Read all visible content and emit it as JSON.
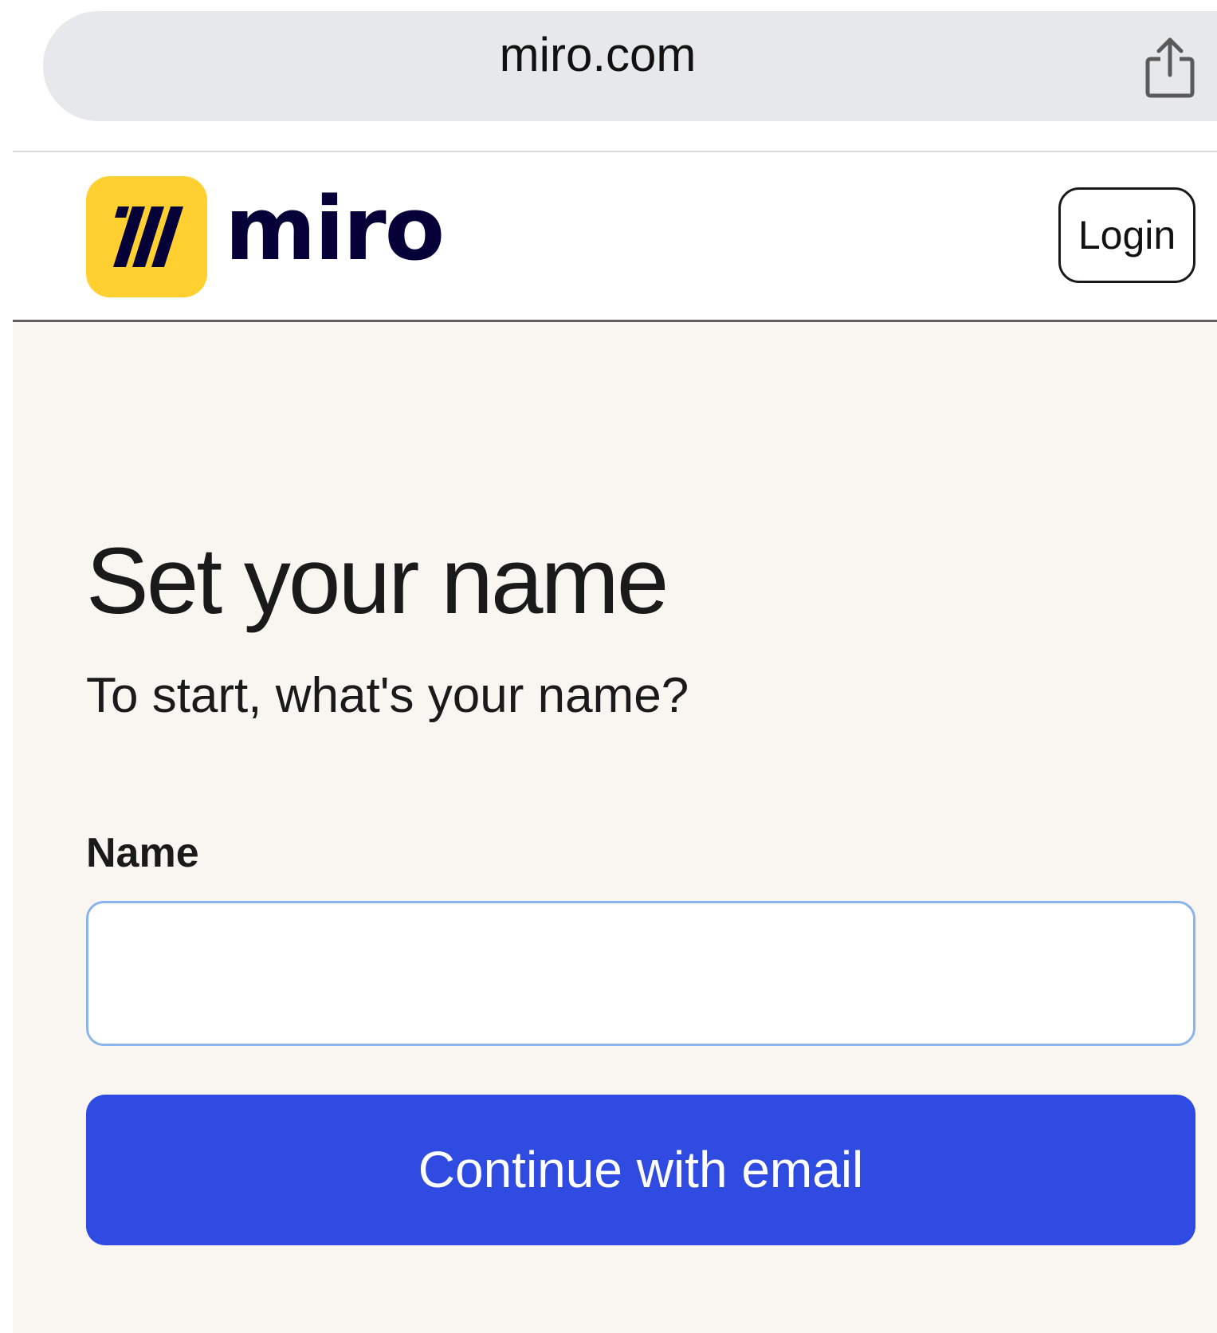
{
  "browser": {
    "url": "miro.com",
    "share_icon": "share-icon"
  },
  "header": {
    "logo_text": "miro",
    "logo_icon": "miro-logo-icon",
    "login_label": "Login"
  },
  "main": {
    "title": "Set your name",
    "subtitle": "To start, what's your name?",
    "name_label": "Name",
    "name_value": "",
    "continue_label": "Continue with email"
  },
  "colors": {
    "brand_yellow": "#ffd02f",
    "primary_blue": "#304be2",
    "page_background": "#f9f6f1",
    "url_bar": "#e6e8eb",
    "input_focus_border": "#8cb4ec"
  }
}
